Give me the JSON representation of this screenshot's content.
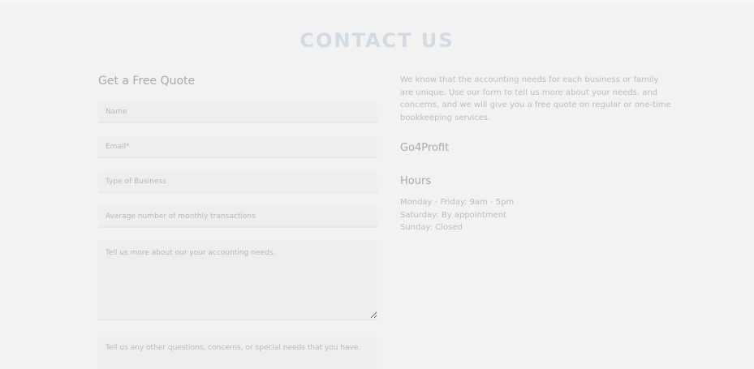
{
  "page_title": "CONTACT US",
  "form": {
    "heading": "Get a Free Quote",
    "fields": {
      "name_placeholder": "Name",
      "email_placeholder": "Email*",
      "business_placeholder": "Type of Business",
      "transactions_placeholder": "Average number of monthly transactions",
      "needs_placeholder": "Tell us more about our your accounting needs.",
      "questions_placeholder": "Tell us any other questions, concerns, or special needs that you have."
    }
  },
  "info": {
    "intro": "We know that the accounting needs for each business or family are unique. Use our form to tell us more about your needs, and concerns, and we will give you a free quote on regular or one-time bookkeeping services.",
    "company_name": "Go4Profit",
    "hours_heading": "Hours",
    "hours": [
      "Monday - Friday: 9am - 5pm",
      "Saturday: By appointment",
      "Sunday: Closed"
    ]
  },
  "colors": {
    "background": "#f2f2f2",
    "title": "#d2dbe3",
    "heading": "#a9a9a9",
    "body_text": "#bdbdbd",
    "field_bg": "#eeeeee"
  }
}
